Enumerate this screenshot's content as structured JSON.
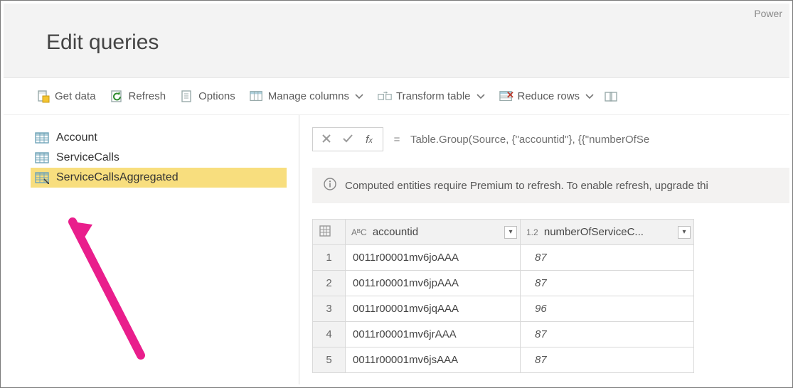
{
  "brand": "Power",
  "header": {
    "title": "Edit queries"
  },
  "toolbar": {
    "get_data": "Get data",
    "refresh": "Refresh",
    "options": "Options",
    "manage_columns": "Manage columns",
    "transform_table": "Transform table",
    "reduce_rows": "Reduce rows"
  },
  "queries": [
    {
      "name": "Account",
      "type": "table",
      "selected": false
    },
    {
      "name": "ServiceCalls",
      "type": "table",
      "selected": false
    },
    {
      "name": "ServiceCallsAggregated",
      "type": "computed",
      "selected": true
    }
  ],
  "formula_bar": {
    "eq": "=",
    "formula": "Table.Group(Source, {\"accountid\"}, {{\"numberOfSe"
  },
  "notice": "Computed entities require Premium to refresh. To enable refresh, upgrade thi",
  "columns": [
    {
      "type_prefix": "AᴮC",
      "label": "accountid"
    },
    {
      "type_prefix": "1.2",
      "label": "numberOfServiceC..."
    }
  ],
  "rows": [
    {
      "n": 1,
      "accountid": "0011r00001mv6joAAA",
      "value": 87
    },
    {
      "n": 2,
      "accountid": "0011r00001mv6jpAAA",
      "value": 87
    },
    {
      "n": 3,
      "accountid": "0011r00001mv6jqAAA",
      "value": 96
    },
    {
      "n": 4,
      "accountid": "0011r00001mv6jrAAA",
      "value": 87
    },
    {
      "n": 5,
      "accountid": "0011r00001mv6jsAAA",
      "value": 87
    }
  ]
}
